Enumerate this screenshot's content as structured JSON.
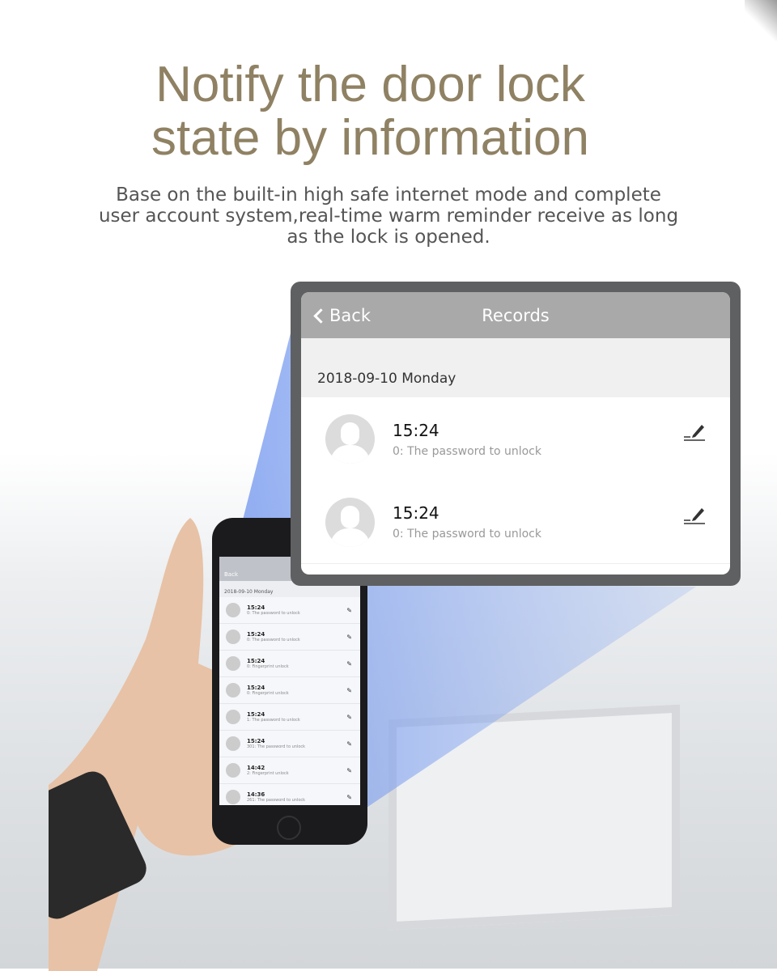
{
  "headline": {
    "line1": "Notify the door lock",
    "line2": "state by information"
  },
  "subtitle": "Base on the built-in high safe internet mode and complete user account system,real-time warm reminder receive as long as the lock is opened.",
  "records_screen": {
    "back_label": "Back",
    "title": "Records",
    "date_header": "2018-09-10 Monday",
    "rows": [
      {
        "time": "15:24",
        "desc": "0:  The password to unlock",
        "icon": "edit-icon"
      },
      {
        "time": "15:24",
        "desc": "0:  The password to unlock",
        "icon": "edit-icon"
      }
    ]
  },
  "phone_screen": {
    "back_label": "Back",
    "date_header": "2018-09-10 Monday",
    "rows": [
      {
        "time": "15:24",
        "desc": "0:  The password to unlock"
      },
      {
        "time": "15:24",
        "desc": "0:  The password to unlock"
      },
      {
        "time": "15:24",
        "desc": "0:  Fingerprint unlock"
      },
      {
        "time": "15:24",
        "desc": "0:  Fingerprint unlock"
      },
      {
        "time": "15:24",
        "desc": "1:  The password to unlock"
      },
      {
        "time": "15:24",
        "desc": "301:  The password to unlock"
      },
      {
        "time": "14:42",
        "desc": "2:  Fingerprint unlock"
      },
      {
        "time": "14:36",
        "desc": "261:  The password to unlock"
      }
    ]
  },
  "colors": {
    "headline": "#8f8163",
    "nav_bar": "#a9a9a9",
    "frame": "#5f6062",
    "beam": "#7fa2f0"
  }
}
